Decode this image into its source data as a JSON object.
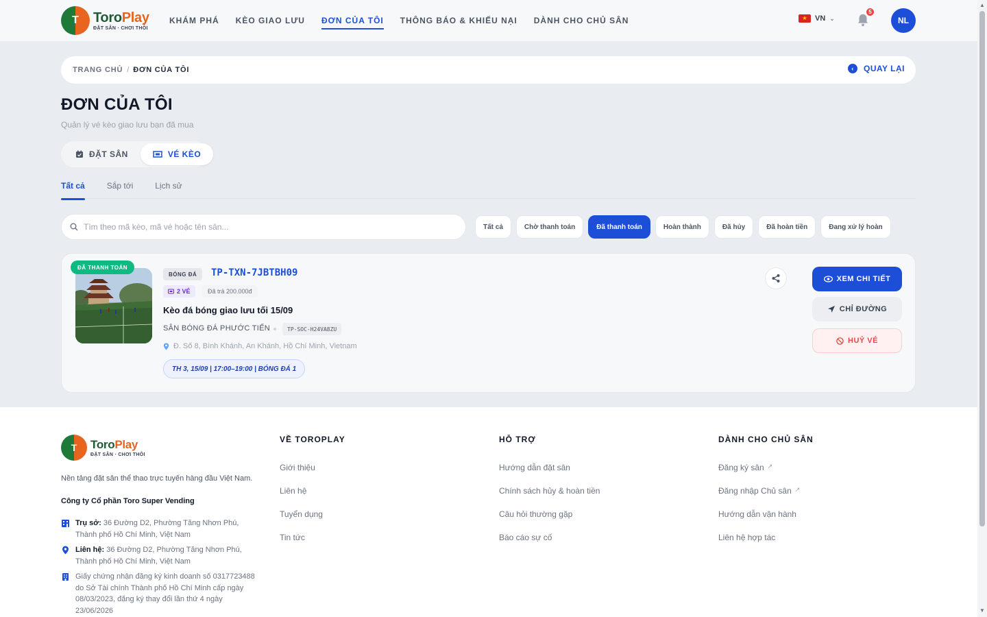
{
  "brand": {
    "logo_letter": "T",
    "name_part1": "Toro",
    "name_part2": "Play",
    "tagline": "ĐẶT SÂN · CHƠI THÔI"
  },
  "nav": {
    "items": [
      {
        "label": "KHÁM PHÁ"
      },
      {
        "label": "KÈO GIAO LƯU"
      },
      {
        "label": "ĐƠN CỦA TÔI"
      },
      {
        "label": "THÔNG BÁO & KHIẾU NẠI"
      },
      {
        "label": "DÀNH CHO CHỦ SÂN"
      }
    ],
    "active_index": 2
  },
  "header": {
    "language": "VN",
    "notification_count": "5",
    "avatar_initials": "NL"
  },
  "breadcrumb": {
    "home": "TRANG CHỦ",
    "separator": "/",
    "current": "ĐƠN CỦA TÔI",
    "back_label": "QUAY LẠI"
  },
  "page": {
    "title": "ĐƠN CỦA TÔI",
    "subtitle": "Quản lý vé kèo giao lưu bạn đã mua"
  },
  "segment": {
    "items": [
      {
        "label": "ĐẶT SÂN",
        "icon": "calendar-check-icon"
      },
      {
        "label": "VÉ KÈO",
        "icon": "ticket-icon"
      }
    ],
    "active_index": 1
  },
  "tabs": {
    "items": [
      {
        "label": "Tất cả"
      },
      {
        "label": "Sắp tới"
      },
      {
        "label": "Lịch sử"
      }
    ],
    "active_index": 0
  },
  "search": {
    "placeholder": "Tìm theo mã kèo, mã vé hoặc tên sân...",
    "value": ""
  },
  "filters": {
    "items": [
      {
        "label": "Tất cả"
      },
      {
        "label": "Chờ thanh toán"
      },
      {
        "label": "Đã thanh toán"
      },
      {
        "label": "Hoàn thành"
      },
      {
        "label": "Đã hủy"
      },
      {
        "label": "Đã hoàn tiền"
      },
      {
        "label": "Đang xử lý hoàn"
      }
    ],
    "active_index": 2
  },
  "order": {
    "status": "ĐÃ THANH TOÁN",
    "sport": "BÓNG ĐÁ",
    "code": "TP-TXN-7JBTBH09",
    "tickets": "2 VÉ",
    "paid": "Đã trả 200.000đ",
    "title": "Kèo đá bóng giao lưu tối 15/09",
    "venue": "SÂN BÓNG ĐÁ PHƯỚC TIẾN",
    "venue_code": "TP-SOC-H24VA8ZU",
    "address": "Đ. Số 8, Bình Khánh, An Khánh, Hồ Chí Minh, Vietnam",
    "schedule": "TH 3, 15/09 | 17:00–19:00 | BÓNG ĐÁ 1",
    "actions": {
      "detail": "XEM CHI TIẾT",
      "directions": "CHỈ ĐƯỜNG",
      "cancel": "HUỶ VÉ"
    }
  },
  "footer": {
    "description": "Nền tảng đặt sân thể thao trực tuyến hàng đầu Việt Nam.",
    "company": "Công ty Cổ phần Toro Super Vending",
    "hq_label": "Trụ sở:",
    "hq_text": "36 Đường D2, Phường Tăng Nhơn Phú, Thành phố Hồ Chí Minh, Việt Nam",
    "contact_label": "Liên hệ:",
    "contact_text": "36 Đường D2, Phường Tăng Nhơn Phú, Thành phố Hồ Chí Minh, Việt Nam",
    "license_text": "Giấy chứng nhận đăng ký kinh doanh số 0317723488 do Sở Tài chính Thành phố Hồ Chí Minh cấp ngày 08/03/2023, đăng ký thay đổi lần thứ 4 ngày 23/06/2026",
    "columns": [
      {
        "title": "VỀ TOROPLAY",
        "links": [
          "Giới thiệu",
          "Liên hệ",
          "Tuyển dụng",
          "Tin tức"
        ]
      },
      {
        "title": "HỖ TRỢ",
        "links": [
          "Hướng dẫn đặt sân",
          "Chính sách hủy & hoàn tiền",
          "Câu hỏi thường gặp",
          "Báo cáo sự cố"
        ]
      },
      {
        "title": "DÀNH CHO CHỦ SÂN",
        "links": [
          "Đăng ký sân",
          "Đăng nhập Chủ sân",
          "Hướng dẫn vận hành",
          "Liên hệ hợp tác"
        ]
      }
    ]
  },
  "colors": {
    "primary": "#1d4ed8",
    "success": "#10b981",
    "danger": "#ef4444",
    "brand_green": "#1f5a36",
    "brand_orange": "#e8641f"
  }
}
